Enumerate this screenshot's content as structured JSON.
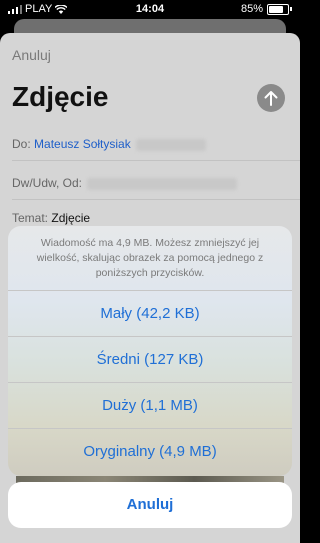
{
  "status_bar": {
    "carrier": "PLAY",
    "time": "14:04",
    "battery": "85%"
  },
  "compose": {
    "cancel_label": "Anuluj",
    "title": "Zdjęcie",
    "to_label": "Do:",
    "to_value": "Mateusz Sołtysiak",
    "cc_label": "Dw/Udw, Od:",
    "subject_label": "Temat:",
    "subject_value": "Zdjęcie"
  },
  "action_sheet": {
    "message": "Wiadomość ma 4,9 MB. Możesz zmniejszyć jej wielkość, skalując obrazek za pomocą jednego z poniższych przycisków.",
    "options": [
      "Mały (42,2 KB)",
      "Średni (127 KB)",
      "Duży (1,1 MB)",
      "Oryginalny (4,9 MB)"
    ],
    "cancel_label": "Anuluj"
  },
  "colors": {
    "accent": "#1f6fd6",
    "dim_overlay": "#d5d5d5"
  }
}
